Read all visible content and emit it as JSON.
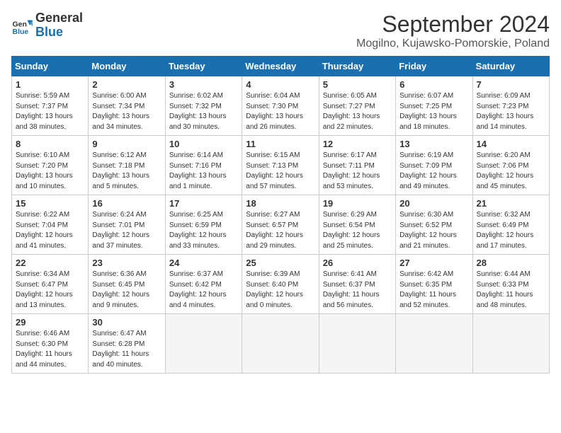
{
  "logo": {
    "general": "General",
    "blue": "Blue"
  },
  "title": "September 2024",
  "subtitle": "Mogilno, Kujawsko-Pomorskie, Poland",
  "days": [
    "Sunday",
    "Monday",
    "Tuesday",
    "Wednesday",
    "Thursday",
    "Friday",
    "Saturday"
  ],
  "weeks": [
    [
      {
        "day": "1",
        "sunrise": "5:59 AM",
        "sunset": "7:37 PM",
        "daylight": "13 hours and 38 minutes."
      },
      {
        "day": "2",
        "sunrise": "6:00 AM",
        "sunset": "7:34 PM",
        "daylight": "13 hours and 34 minutes."
      },
      {
        "day": "3",
        "sunrise": "6:02 AM",
        "sunset": "7:32 PM",
        "daylight": "13 hours and 30 minutes."
      },
      {
        "day": "4",
        "sunrise": "6:04 AM",
        "sunset": "7:30 PM",
        "daylight": "13 hours and 26 minutes."
      },
      {
        "day": "5",
        "sunrise": "6:05 AM",
        "sunset": "7:27 PM",
        "daylight": "13 hours and 22 minutes."
      },
      {
        "day": "6",
        "sunrise": "6:07 AM",
        "sunset": "7:25 PM",
        "daylight": "13 hours and 18 minutes."
      },
      {
        "day": "7",
        "sunrise": "6:09 AM",
        "sunset": "7:23 PM",
        "daylight": "13 hours and 14 minutes."
      }
    ],
    [
      {
        "day": "8",
        "sunrise": "6:10 AM",
        "sunset": "7:20 PM",
        "daylight": "13 hours and 10 minutes."
      },
      {
        "day": "9",
        "sunrise": "6:12 AM",
        "sunset": "7:18 PM",
        "daylight": "13 hours and 5 minutes."
      },
      {
        "day": "10",
        "sunrise": "6:14 AM",
        "sunset": "7:16 PM",
        "daylight": "13 hours and 1 minute."
      },
      {
        "day": "11",
        "sunrise": "6:15 AM",
        "sunset": "7:13 PM",
        "daylight": "12 hours and 57 minutes."
      },
      {
        "day": "12",
        "sunrise": "6:17 AM",
        "sunset": "7:11 PM",
        "daylight": "12 hours and 53 minutes."
      },
      {
        "day": "13",
        "sunrise": "6:19 AM",
        "sunset": "7:09 PM",
        "daylight": "12 hours and 49 minutes."
      },
      {
        "day": "14",
        "sunrise": "6:20 AM",
        "sunset": "7:06 PM",
        "daylight": "12 hours and 45 minutes."
      }
    ],
    [
      {
        "day": "15",
        "sunrise": "6:22 AM",
        "sunset": "7:04 PM",
        "daylight": "12 hours and 41 minutes."
      },
      {
        "day": "16",
        "sunrise": "6:24 AM",
        "sunset": "7:01 PM",
        "daylight": "12 hours and 37 minutes."
      },
      {
        "day": "17",
        "sunrise": "6:25 AM",
        "sunset": "6:59 PM",
        "daylight": "12 hours and 33 minutes."
      },
      {
        "day": "18",
        "sunrise": "6:27 AM",
        "sunset": "6:57 PM",
        "daylight": "12 hours and 29 minutes."
      },
      {
        "day": "19",
        "sunrise": "6:29 AM",
        "sunset": "6:54 PM",
        "daylight": "12 hours and 25 minutes."
      },
      {
        "day": "20",
        "sunrise": "6:30 AM",
        "sunset": "6:52 PM",
        "daylight": "12 hours and 21 minutes."
      },
      {
        "day": "21",
        "sunrise": "6:32 AM",
        "sunset": "6:49 PM",
        "daylight": "12 hours and 17 minutes."
      }
    ],
    [
      {
        "day": "22",
        "sunrise": "6:34 AM",
        "sunset": "6:47 PM",
        "daylight": "12 hours and 13 minutes."
      },
      {
        "day": "23",
        "sunrise": "6:36 AM",
        "sunset": "6:45 PM",
        "daylight": "12 hours and 9 minutes."
      },
      {
        "day": "24",
        "sunrise": "6:37 AM",
        "sunset": "6:42 PM",
        "daylight": "12 hours and 4 minutes."
      },
      {
        "day": "25",
        "sunrise": "6:39 AM",
        "sunset": "6:40 PM",
        "daylight": "12 hours and 0 minutes."
      },
      {
        "day": "26",
        "sunrise": "6:41 AM",
        "sunset": "6:37 PM",
        "daylight": "11 hours and 56 minutes."
      },
      {
        "day": "27",
        "sunrise": "6:42 AM",
        "sunset": "6:35 PM",
        "daylight": "11 hours and 52 minutes."
      },
      {
        "day": "28",
        "sunrise": "6:44 AM",
        "sunset": "6:33 PM",
        "daylight": "11 hours and 48 minutes."
      }
    ],
    [
      {
        "day": "29",
        "sunrise": "6:46 AM",
        "sunset": "6:30 PM",
        "daylight": "11 hours and 44 minutes."
      },
      {
        "day": "30",
        "sunrise": "6:47 AM",
        "sunset": "6:28 PM",
        "daylight": "11 hours and 40 minutes."
      },
      null,
      null,
      null,
      null,
      null
    ]
  ]
}
